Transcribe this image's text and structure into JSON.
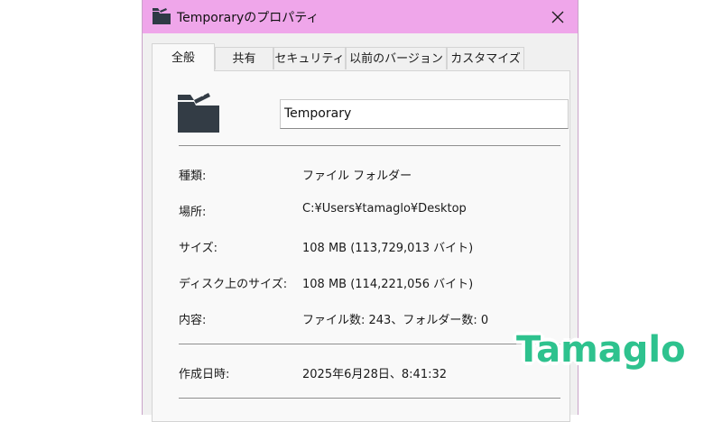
{
  "window": {
    "title": "Temporaryのプロパティ",
    "icon": "folder-icon",
    "close_icon": "close-icon"
  },
  "tabs": [
    {
      "label": "全般",
      "active": true
    },
    {
      "label": "共有",
      "active": false
    },
    {
      "label": "セキュリティ",
      "active": false
    },
    {
      "label": "以前のバージョン",
      "active": false
    },
    {
      "label": "カスタマイズ",
      "active": false
    }
  ],
  "general": {
    "folder_name": "Temporary",
    "rows": [
      {
        "label": "種類:",
        "value": "ファイル フォルダー"
      },
      {
        "label": "場所:",
        "value": "C:¥Users¥tamaglo¥Desktop"
      },
      {
        "label": "サイズ:",
        "value": "108 MB (113,729,013 バイト)"
      },
      {
        "label": "ディスク上のサイズ:",
        "value": "108 MB (114,221,056 バイト)"
      },
      {
        "label": "内容:",
        "value": "ファイル数: 243、フォルダー数: 0"
      },
      {
        "label": "作成日時:",
        "value": "2025年6月28日、8:41:32"
      }
    ]
  },
  "watermark": "Tamaglo",
  "colors": {
    "titlebar": "#efa6ea",
    "watermark": "#2ec28e"
  }
}
